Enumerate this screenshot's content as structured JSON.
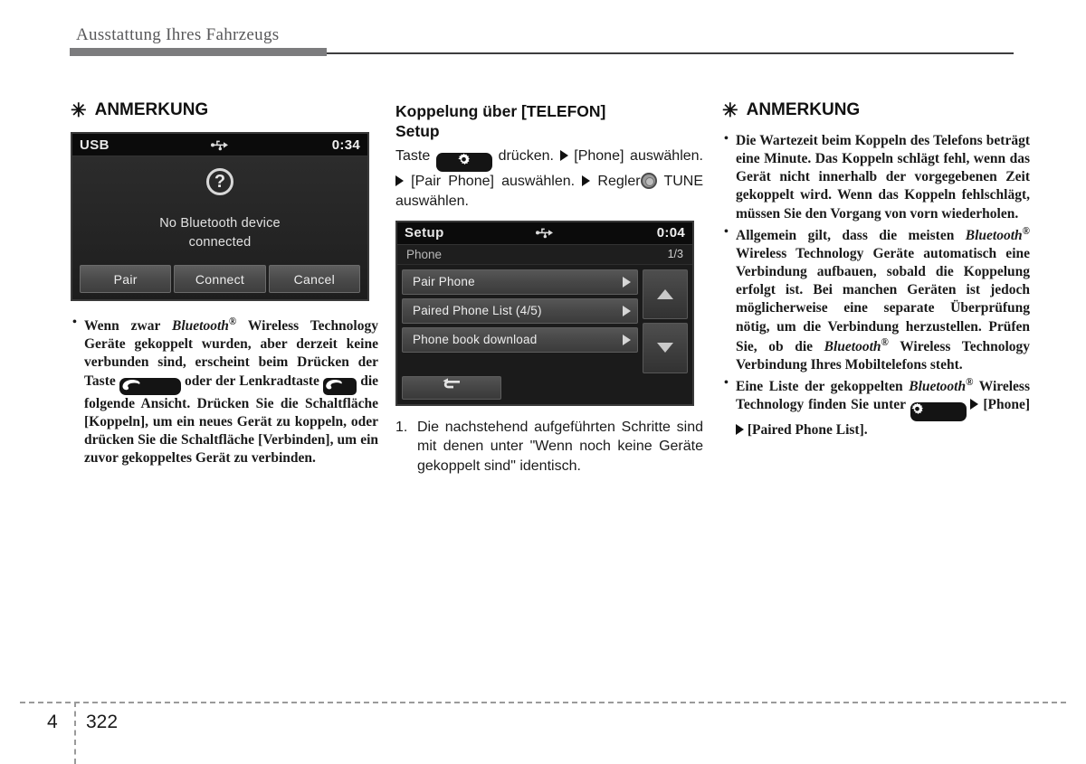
{
  "header": {
    "title": "Ausstattung Ihres Fahrzeugs"
  },
  "footer": {
    "chapter": "4",
    "page": "322"
  },
  "left_column": {
    "note_heading": "ANMERKUNG",
    "asterisk": "✳",
    "usb_screen": {
      "title": "USB",
      "usb_icon": "usb-icon",
      "clock": "0:34",
      "question_mark": "?",
      "message_line1": "No Bluetooth device",
      "message_line2": "connected",
      "buttons": [
        {
          "label": "Pair"
        },
        {
          "label": "Connect"
        },
        {
          "label": "Cancel"
        }
      ]
    },
    "bullet": {
      "p1": "Wenn zwar ",
      "bt": "Bluetooth",
      "reg": "®",
      "p2": " Wireless Technology Geräte gekoppelt wurden, aber derzeit keine verbunden sind, erscheint beim Drücken der Taste",
      "p3": " oder der Lenkradtaste",
      "p4": " die folgende Ansicht. Drücken Sie die Schaltfläche [Koppeln], um ein neues Gerät zu koppeln, oder drücken Sie die Schaltfläche [Verbinden], um ein zuvor gekoppeltes Gerät zu verbinden."
    }
  },
  "middle_column": {
    "section_heading_line1": "Koppelung über [TELEFON]",
    "section_heading_line2": "Setup",
    "instruction": {
      "t1": "Taste",
      "gear_icon": "gear-icon",
      "t2": "drücken.",
      "arrow": "▶",
      "t3": "[Phone] auswählen.",
      "t4": "[Pair Phone] auswählen.",
      "t5": "Regler",
      "knob_icon": "tune-knob-icon",
      "t6": "TUNE auswählen."
    },
    "setup_screen": {
      "title": "Setup",
      "usb_icon": "usb-icon",
      "clock": "0:04",
      "subtitle": "Phone",
      "page_indicator": "1/3",
      "rows": [
        {
          "label": "Pair Phone"
        },
        {
          "label": "Paired Phone List  (4/5)"
        },
        {
          "label": "Phone book download"
        }
      ],
      "scroll_up": "scroll-up-icon",
      "scroll_down": "scroll-down-icon",
      "back_button": "back-icon"
    },
    "numbered_item": {
      "number": "1.",
      "text": "Die nachstehend aufgeführten Schritte sind mit denen unter \"Wenn noch keine Geräte gekoppelt sind\" identisch."
    }
  },
  "right_column": {
    "note_heading": "ANMERKUNG",
    "asterisk": "✳",
    "bullets": [
      {
        "text": "Die Wartezeit beim Koppeln des Telefons beträgt eine Minute. Das Koppeln schlägt fehl, wenn das Gerät nicht innerhalb der vorgegebenen Zeit gekoppelt wird. Wenn das Koppeln fehlschlägt, müssen Sie den Vorgang von vorn wiederholen."
      },
      {
        "a": "Allgemein gilt, dass die meisten ",
        "bt1": "Bluetooth",
        "reg1": "®",
        "b": " Wireless Technology Geräte automatisch eine Verbindung aufbauen, sobald die Koppelung erfolgt ist. Bei manchen Geräten ist jedoch möglicherweise eine separate Überprüfung nötig, um die Verbindung herzustellen. Prüfen Sie, ob die ",
        "bt2": "Bluetooth",
        "reg2": "®",
        "c": " Wireless Technology Verbindung Ihres Mobiltelefons steht."
      },
      {
        "a": "Eine Liste der gekoppelten ",
        "bt1": "Bluetooth",
        "reg1": "®",
        "b": " Wireless Technology finden Sie unter",
        "gear_icon": "gear-icon",
        "arrow": "▶",
        "c": "[Phone]",
        "d": "[Paired Phone List]."
      }
    ]
  },
  "colors": {
    "header_text": "#58585a",
    "header_bar": "#7c7c7e",
    "body_text": "#1a1a1a",
    "screen_bg": "#1b1b1b",
    "screen_titlebar": "#0b0b0b",
    "button_face": "#4a4a4a"
  }
}
